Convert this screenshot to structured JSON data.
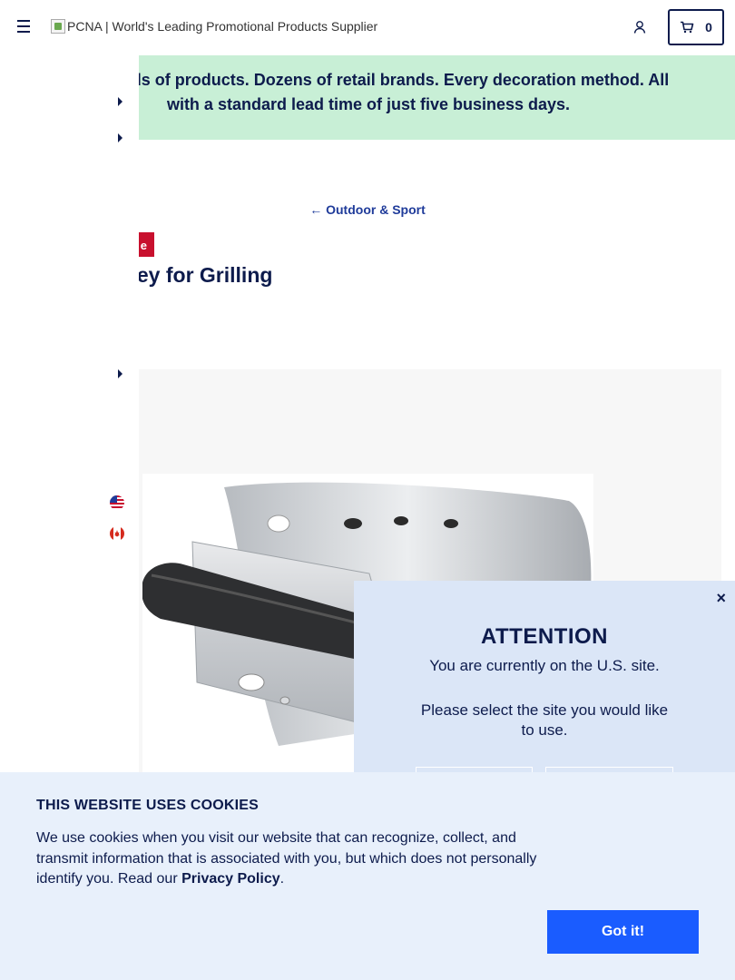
{
  "header": {
    "logo_alt": "PCNA | World's Leading Promotional Products Supplier",
    "cart_count": "0"
  },
  "banner": {
    "line1": "usands of products. Dozens of retail brands. Every decoration method. All",
    "line2": "with a standard lead time of just five business days."
  },
  "breadcrumb": {
    "arrow": "←",
    "label": "Outdoor & Sport"
  },
  "product": {
    "badge": "e",
    "title": "imney for Grilling"
  },
  "attention": {
    "close": "×",
    "title": "ATTENTION",
    "message": "You are currently on the U.S. site.",
    "prompt": "Please select the site you would like to use."
  },
  "cookie": {
    "heading": "THIS WEBSITE USES COOKIES",
    "body": "We use cookies when you visit our website that can recognize, collect, and transmit information that is associated with you, but which does not personally identify you. Read our ",
    "link": "Privacy Policy",
    "period": ".",
    "button": "Got it!"
  },
  "colors": {
    "navy": "#0d1b4c",
    "banner_bg": "#c8efd6",
    "sale_red": "#c8102e",
    "cookie_bg": "#e8f0fb",
    "modal_bg": "#dbe6f7",
    "button_blue": "#1a5cff"
  }
}
